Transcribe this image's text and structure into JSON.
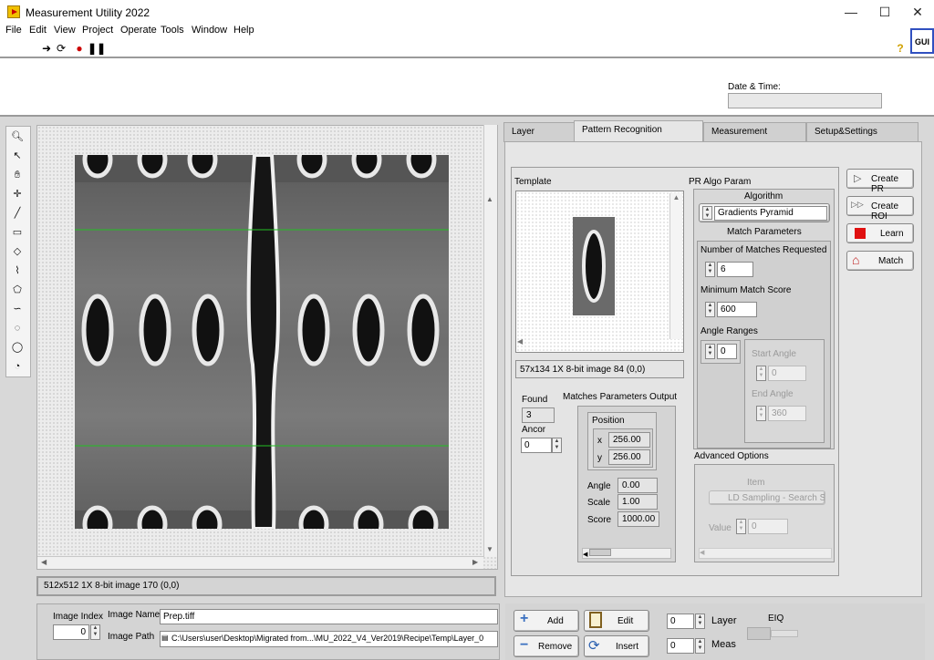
{
  "window": {
    "title": "Measurement Utility 2022",
    "minimize": "—",
    "maximize": "☐",
    "close": "✕"
  },
  "menu": [
    "File",
    "Edit",
    "View",
    "Project",
    "Operate",
    "Tools",
    "Window",
    "Help"
  ],
  "gui_badge": "GUI",
  "date_time": {
    "label": "Date & Time:",
    "value": ""
  },
  "viewer": {
    "status": "512x512 1X 8-bit image 170    (0,0)"
  },
  "tabs": [
    "Layer",
    "Pattern Recognition",
    "Measurement",
    "Setup&Settings"
  ],
  "pr": {
    "template_label": "Template",
    "template_status": "57x134 1X 8-bit image 84    (0,0)",
    "algo_param_label": "PR  Algo Param",
    "algorithm_label": "Algorithm",
    "algorithm_value": "Gradients Pyramid",
    "match_params_label": "Match Parameters",
    "num_matches_label": "Number of Matches Requested",
    "num_matches_value": "6",
    "min_score_label": "Minimum Match Score",
    "min_score_value": "600",
    "angle_ranges_label": "Angle Ranges",
    "angle_index": "0",
    "start_angle_label": "Start Angle",
    "start_angle_value": "0",
    "end_angle_label": "End Angle",
    "end_angle_value": "360",
    "advanced_label": "Advanced Options",
    "item_label": "Item",
    "item_value": "LD Sampling - Search Str",
    "value_label": "Value",
    "value_value": "0",
    "found_label": "Found",
    "found_value": "3",
    "ancor_label": "Ancor",
    "ancor_value": "0",
    "output_label": "Matches Parameters Output",
    "position_label": "Position",
    "x_label": "x",
    "x_value": "256.00",
    "y_label": "y",
    "y_value": "256.00",
    "angle_label": "Angle",
    "angle_value": "0.00",
    "scale_label": "Scale",
    "scale_value": "1.00",
    "score_label": "Score",
    "score_value": "1000.00"
  },
  "side_buttons": [
    "Create PR",
    "Create ROI",
    "Learn",
    "Match"
  ],
  "bottom": {
    "image_index_label": "Image Index",
    "image_index_value": "0",
    "image_name_label": "Image Name",
    "image_name_value": "Prep.tiff",
    "image_path_label": "Image Path",
    "image_path_value": "C:\\Users\\user\\Desktop\\Migrated from...\\MU_2022_V4_Ver2019\\Recipe\\Temp\\Layer_0",
    "add": "Add",
    "remove": "Remove",
    "edit": "Edit",
    "insert": "Insert",
    "layer_label": "Layer",
    "layer_value": "0",
    "meas_label": "Meas",
    "meas_value": "0",
    "eiq_label": "EIQ"
  },
  "colors": {
    "green_line": "#22c022",
    "learn_red": "#e01010",
    "accent_blue": "#3050c0"
  }
}
